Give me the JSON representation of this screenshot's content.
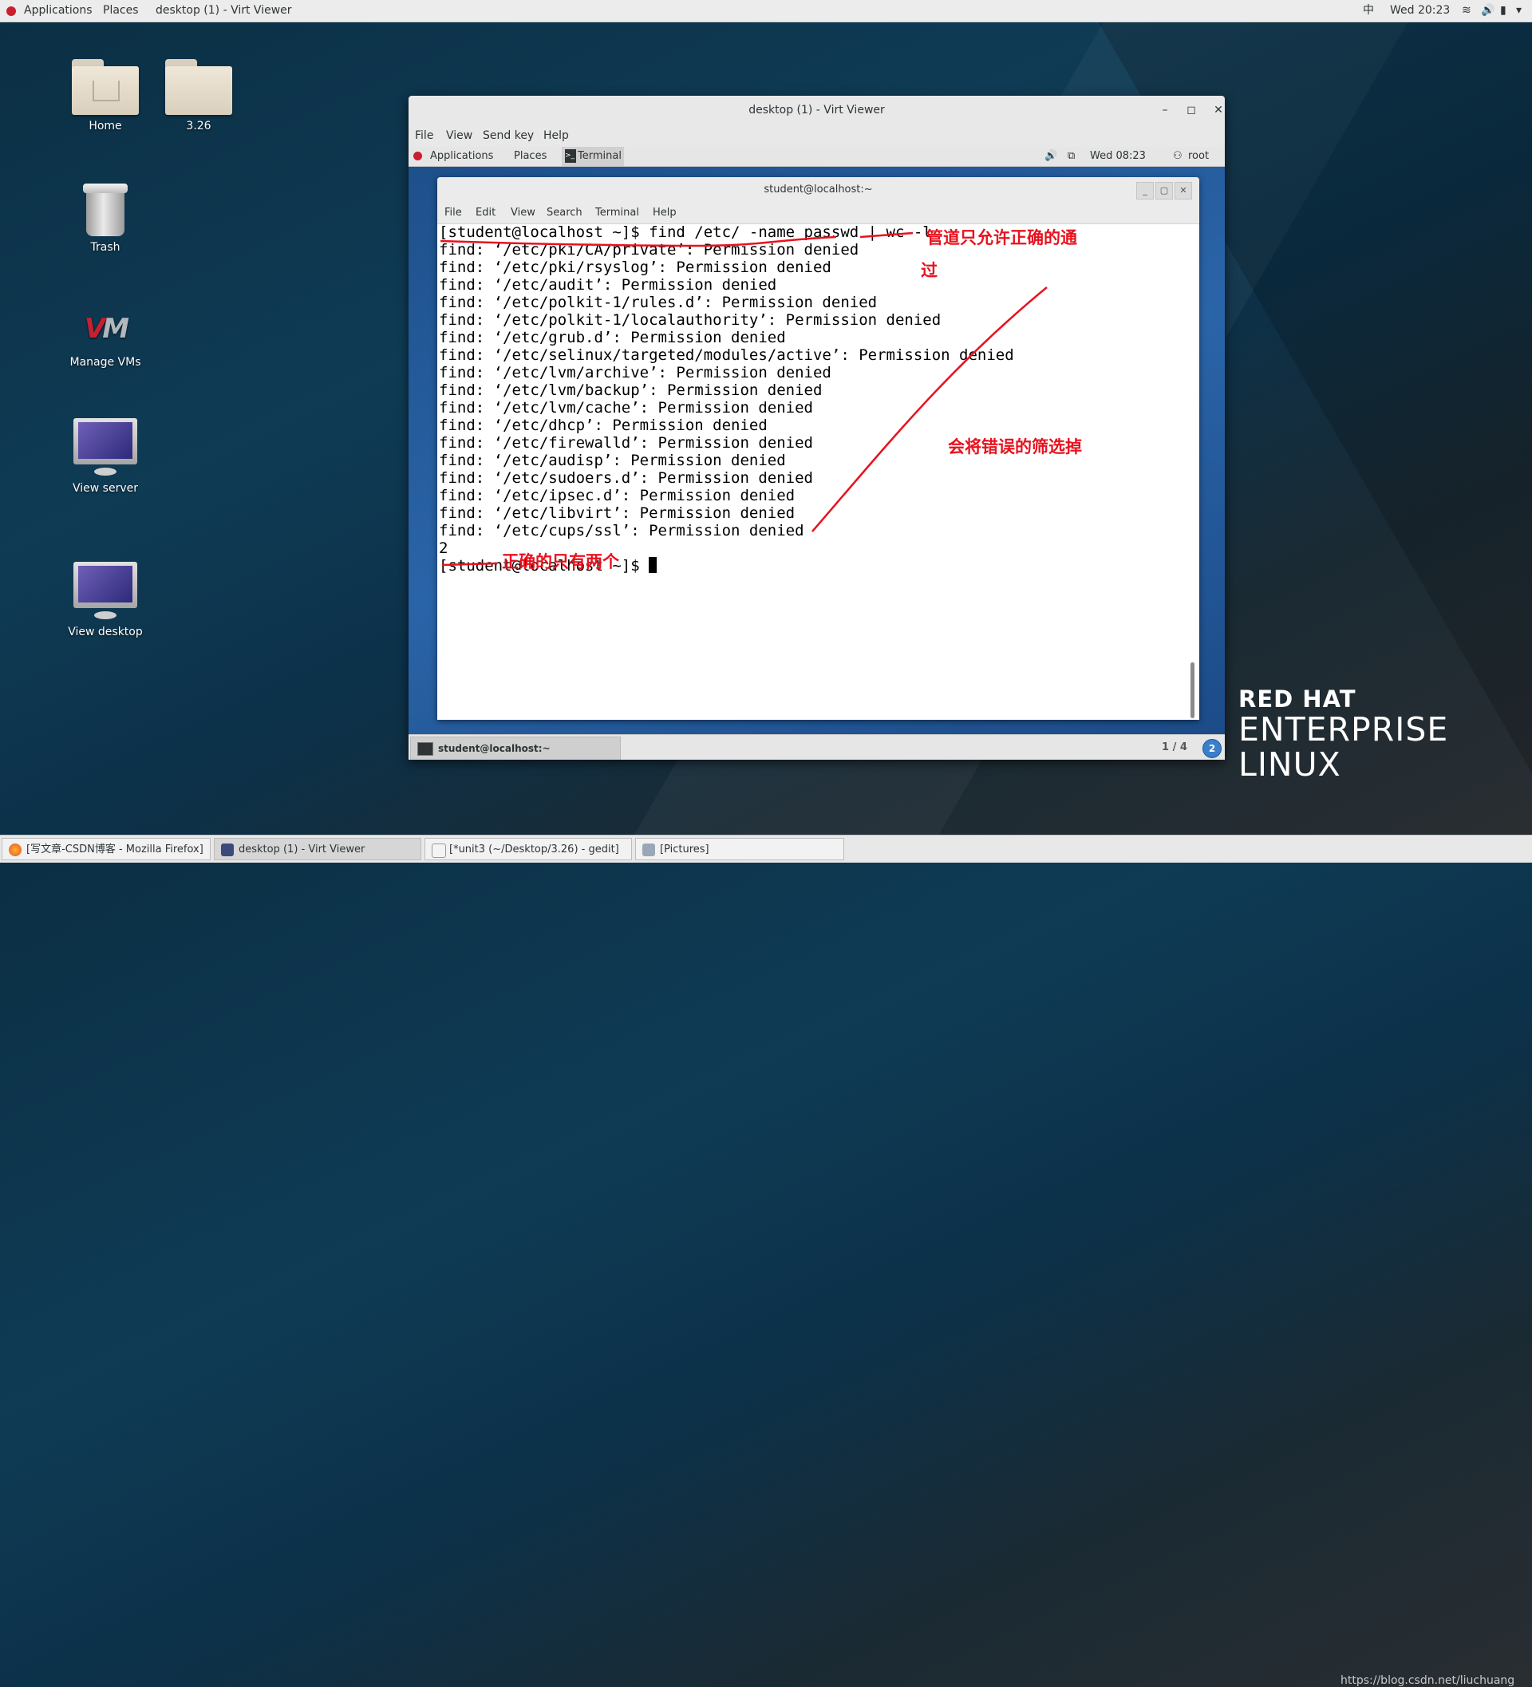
{
  "host_panel": {
    "applications": "Applications",
    "places": "Places",
    "window_title": "desktop (1) - Virt Viewer",
    "input_method": "中",
    "clock": "Wed 20:23"
  },
  "desktop_icons": [
    {
      "label": "Home"
    },
    {
      "label": "3.26"
    },
    {
      "label": "Trash"
    },
    {
      "label": "Manage VMs"
    },
    {
      "label": "View server"
    },
    {
      "label": "View desktop"
    }
  ],
  "virt_viewer": {
    "title": "desktop (1) - Virt Viewer",
    "minimize": "–",
    "maximize": "◻",
    "close": "✕",
    "menu": [
      "File",
      "View",
      "Send key",
      "Help"
    ]
  },
  "guest_panel": {
    "applications": "Applications",
    "places": "Places",
    "terminal_tab": "Terminal",
    "clock": "Wed 08:23",
    "user": "root"
  },
  "terminal": {
    "title": "student@localhost:~",
    "menu": [
      "File",
      "Edit",
      "View",
      "Search",
      "Terminal",
      "Help"
    ],
    "lines": [
      "[student@localhost ~]$ find /etc/ -name passwd | wc -l",
      "find: ‘/etc/pki/CA/private’: Permission denied",
      "find: ‘/etc/pki/rsyslog’: Permission denied",
      "find: ‘/etc/audit’: Permission denied",
      "find: ‘/etc/polkit-1/rules.d’: Permission denied",
      "find: ‘/etc/polkit-1/localauthority’: Permission denied",
      "find: ‘/etc/grub.d’: Permission denied",
      "find: ‘/etc/selinux/targeted/modules/active’: Permission denied",
      "find: ‘/etc/lvm/archive’: Permission denied",
      "find: ‘/etc/lvm/backup’: Permission denied",
      "find: ‘/etc/lvm/cache’: Permission denied",
      "find: ‘/etc/dhcp’: Permission denied",
      "find: ‘/etc/firewalld’: Permission denied",
      "find: ‘/etc/audisp’: Permission denied",
      "find: ‘/etc/sudoers.d’: Permission denied",
      "find: ‘/etc/ipsec.d’: Permission denied",
      "find: ‘/etc/libvirt’: Permission denied",
      "find: ‘/etc/cups/ssl’: Permission denied",
      "2"
    ],
    "prompt": "[student@localhost ~]$ "
  },
  "annotations": {
    "pipe_note_1": "管道只允许正确的通",
    "pipe_note_2": "过",
    "filter_note": "会将错误的筛选掉",
    "count_note": "正确的只有两个"
  },
  "guest_taskbar": {
    "task": "student@localhost:~",
    "workspace": "1 / 4",
    "badge": "2"
  },
  "rhel_logo": {
    "line1": "RED HAT",
    "line2": "ENTERPRISE",
    "line3": "LINUX"
  },
  "host_taskbar": {
    "items": [
      "[写文章-CSDN博客 - Mozilla Firefox]",
      "desktop (1) - Virt Viewer",
      "[*unit3 (~/Desktop/3.26) - gedit]",
      "[Pictures]"
    ],
    "watermark": "https://blog.csdn.net/liuchuang"
  },
  "colors": {
    "annotation_red": "#e8121e",
    "guest_bg": "#2a64a8"
  }
}
